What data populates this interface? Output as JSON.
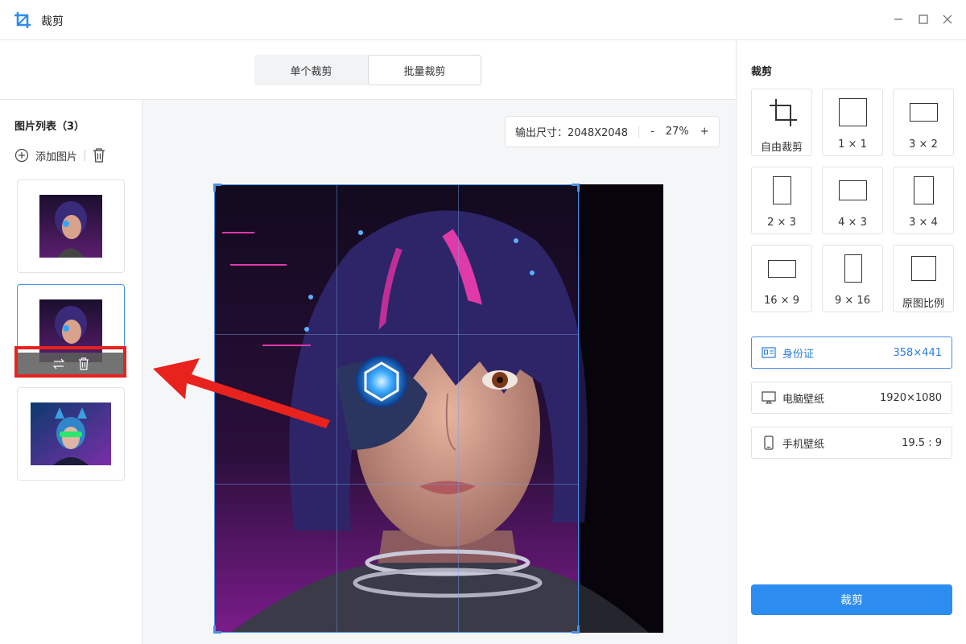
{
  "window": {
    "title": "裁剪"
  },
  "tabs": [
    {
      "label": "单个裁剪",
      "active": false
    },
    {
      "label": "批量裁剪",
      "active": true
    }
  ],
  "sidebar": {
    "title": "图片列表（3）",
    "add_label": "添加图片",
    "thumbnails": [
      {
        "name": "cyborg-girl-1",
        "selected": false
      },
      {
        "name": "cyborg-girl-2",
        "selected": true
      },
      {
        "name": "cat-ear-girl",
        "selected": false
      }
    ]
  },
  "canvas": {
    "output_label": "输出尺寸：2048X2048",
    "zoom_minus": "-",
    "zoom_value": "27%",
    "zoom_plus": "+"
  },
  "right_panel": {
    "title": "裁剪",
    "ratios": [
      {
        "label": "自由裁剪",
        "icon": "crop-icon"
      },
      {
        "label": "1 × 1"
      },
      {
        "label": "3 × 2"
      },
      {
        "label": "2 × 3"
      },
      {
        "label": "4 × 3"
      },
      {
        "label": "3 × 4"
      },
      {
        "label": "16 × 9"
      },
      {
        "label": "9 × 16"
      },
      {
        "label": "原图比例"
      }
    ],
    "presets": [
      {
        "label": "身份证",
        "value": "358×441",
        "icon": "id-card-icon",
        "active": true
      },
      {
        "label": "电脑壁纸",
        "value": "1920×1080",
        "icon": "monitor-icon",
        "active": false
      },
      {
        "label": "手机壁纸",
        "value": "19.5 : 9",
        "icon": "phone-icon",
        "active": false
      }
    ],
    "crop_button": "裁剪"
  },
  "colors": {
    "accent": "#2d8cf0",
    "frame": "#4a90e2",
    "annotation": "#e8221c"
  }
}
